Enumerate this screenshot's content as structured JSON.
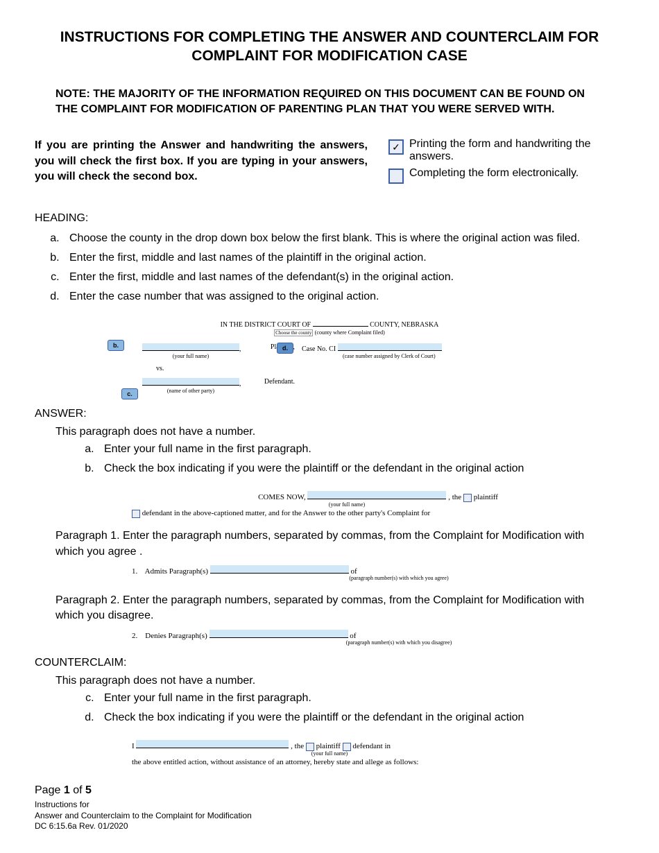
{
  "title": "INSTRUCTIONS FOR COMPLETING THE ANSWER AND COUNTERCLAIM FOR COMPLAINT FOR MODIFICATION CASE",
  "note": "NOTE: THE MAJORITY OF THE INFORMATION REQUIRED ON THIS DOCUMENT CAN BE FOUND ON THE COMPLAINT FOR MODIFICATION OF PARENTING PLAN THAT YOU WERE SERVED WITH.",
  "intro": "If you are printing the Answer and handwriting the answers, you will check the first box. If you are typing in your answers, you will check the second box.",
  "cb": {
    "print": "Printing the form and handwriting the answers.",
    "electronic": "Completing the form electronically."
  },
  "heading": {
    "label": "HEADING:",
    "a": "Choose the county in the drop down box below the first blank. This is where the original action was filed.",
    "b": "Enter the first, middle and last names of the plaintiff in the original action.",
    "c": "Enter the first, middle and last names of the defendant(s) in the original action.",
    "d": "Enter the case number that was assigned to the original action."
  },
  "mini": {
    "court_prefix": "IN THE DISTRICT COURT OF",
    "court_suffix": "COUNTY, NEBRASKA",
    "choose_county": "Choose the county",
    "county_hint": "(county where Complaint filed)",
    "your_full_name": "(your full name)",
    "plaintiff": "Plaintiff,",
    "case_no": "Case No. CI",
    "case_caption": "(case number assigned by Clerk of Court)",
    "vs": "vs.",
    "other_party": "(name of other party)",
    "defendant": "Defendant."
  },
  "answer": {
    "label": "ANSWER:",
    "intro": "This paragraph does not have a number.",
    "a": "Enter your full name in the first paragraph.",
    "b": "Check the box indicating if you were the plaintiff or the defendant in the original action",
    "snippet_comes": "COMES NOW,",
    "snippet_the": ", the",
    "snippet_plaintiff": "plaintiff",
    "snippet_def": "defendant in the above-captioned matter, and for the Answer to the other party's Complaint for",
    "p1": "Paragraph 1. Enter the paragraph numbers, separated by commas, from the Complaint for Modification with which you agree .",
    "admits_num": "1.",
    "admits": "Admits Paragraph(s)",
    "admits_caption": "(paragraph number(s) with which you agree)",
    "of": "of",
    "p2": "Paragraph 2. Enter the paragraph numbers, separated by commas, from the Complaint for Modification with which you disagree.",
    "denies_num": "2.",
    "denies": "Denies Paragraph(s)",
    "denies_caption": "(paragraph number(s) with which you disagree)"
  },
  "counterclaim": {
    "label": "COUNTERCLAIM:",
    "intro": "This paragraph does not have a number.",
    "c": "Enter your full name in the first paragraph.",
    "d": "Check the box indicating if you were the plaintiff or the defendant in the original action",
    "snippet_i": "I",
    "snippet_the": ", the",
    "snippet_plaintiff": "plaintiff",
    "snippet_defendant_in": "defendant in",
    "snippet_rest": "the above entitled action, without assistance of an attorney, hereby state and allege as follows:"
  },
  "footer": {
    "page": "Page",
    "num": "1",
    "of": "of",
    "total": "5",
    "line1": "Instructions for",
    "line2": "Answer and Counterclaim to the Complaint for Modification",
    "line3": "DC 6:15.6a Rev. 01/2020"
  }
}
